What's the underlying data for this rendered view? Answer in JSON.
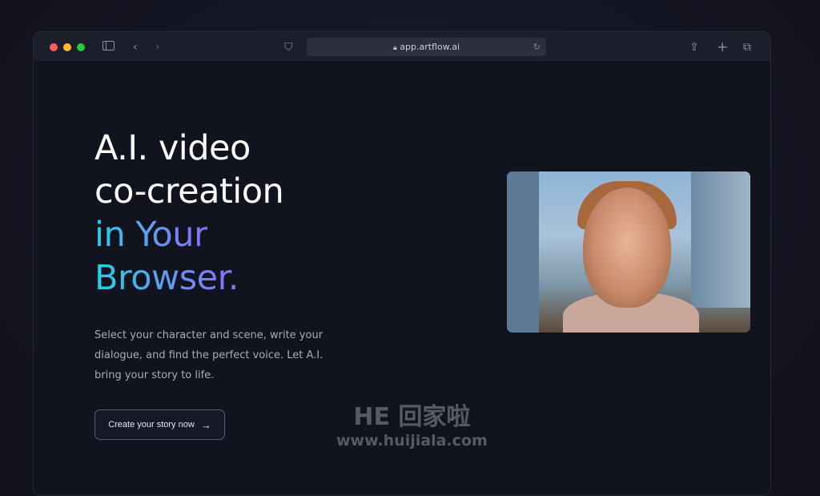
{
  "browser": {
    "url": "app.artflow.ai",
    "traffic_lights": {
      "close": "#ff5f57",
      "minimize": "#febc2e",
      "zoom": "#28c840"
    }
  },
  "hero": {
    "line1": "A.I. video",
    "line2": "co-creation",
    "line3": "in Your",
    "line4": "Browser.",
    "gradient": [
      "#22d3e6",
      "#8b6cf5"
    ]
  },
  "description": "Select your character and scene, write your dialogue, and find the perfect voice. Let A.I. bring your story to life.",
  "cta": {
    "label": "Create your story now",
    "icon": "arrow-right-icon"
  },
  "watermark": {
    "logo": "HE 回家啦",
    "url": "www.huijiala.com"
  }
}
